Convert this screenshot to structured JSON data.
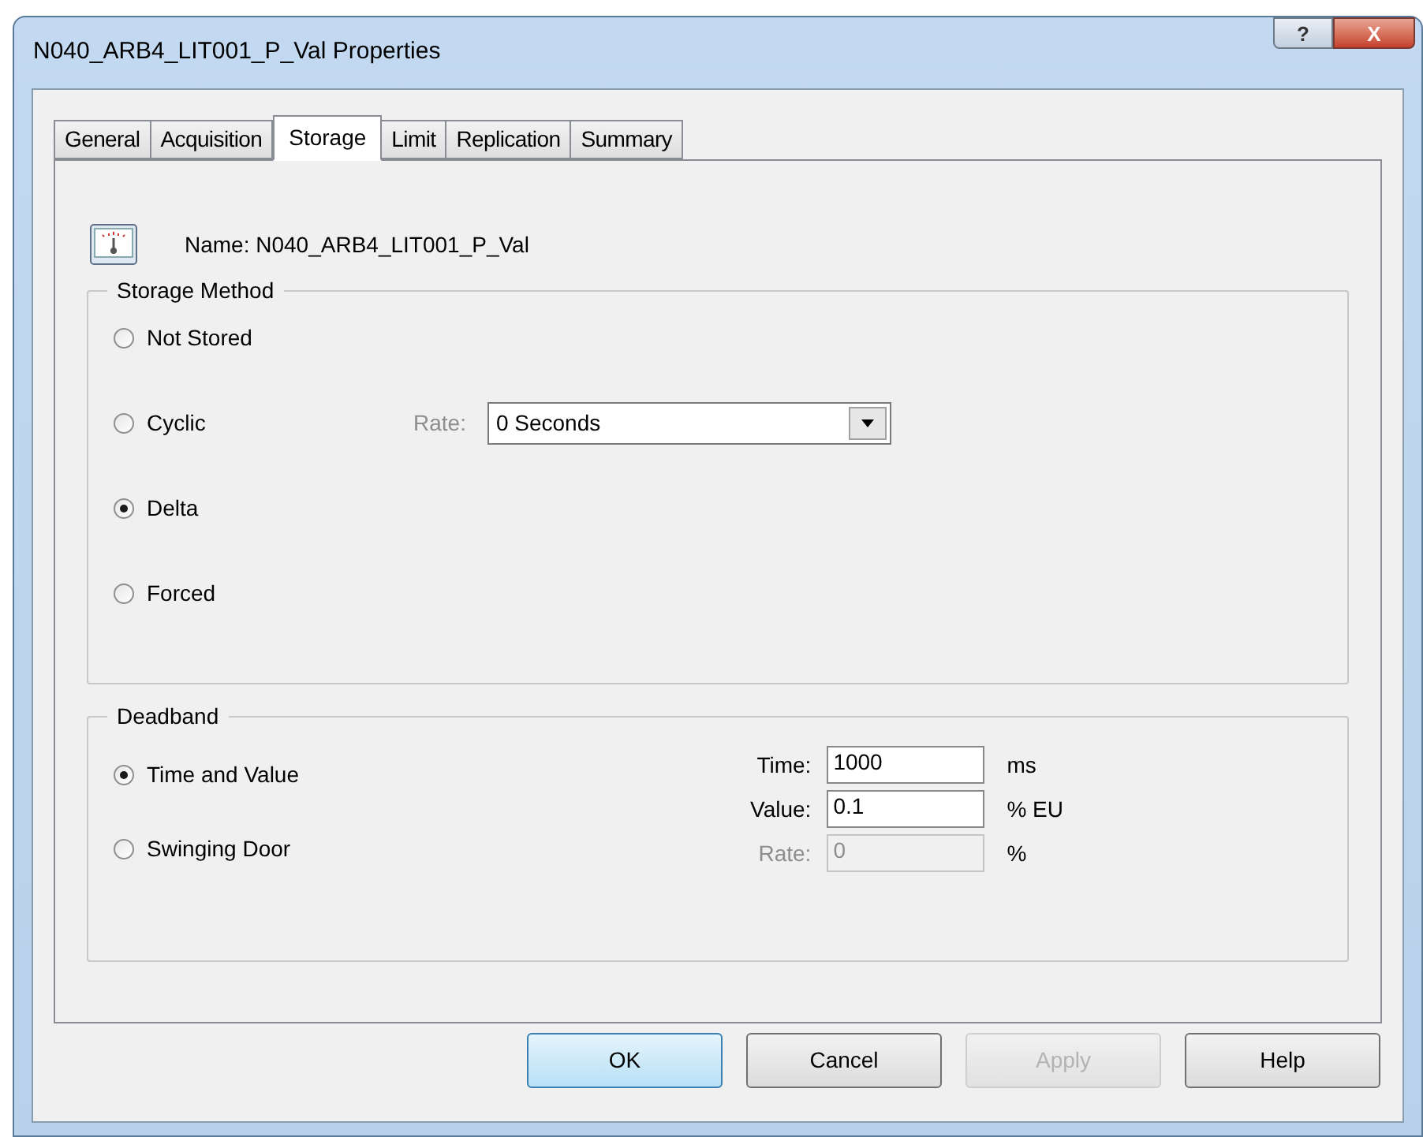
{
  "window": {
    "title": "N040_ARB4_LIT001_P_Val Properties",
    "help_button": "?",
    "close_button": "X"
  },
  "tabs": [
    {
      "label": "General",
      "selected": false
    },
    {
      "label": "Acquisition",
      "selected": false
    },
    {
      "label": "Storage",
      "selected": true
    },
    {
      "label": "Limit",
      "selected": false
    },
    {
      "label": "Replication",
      "selected": false
    },
    {
      "label": "Summary",
      "selected": false
    }
  ],
  "name_label": "Name: N040_ARB4_LIT001_P_Val",
  "storage_method": {
    "title": "Storage Method",
    "options": [
      {
        "label": "Not Stored",
        "selected": false
      },
      {
        "label": "Cyclic",
        "selected": false
      },
      {
        "label": "Delta",
        "selected": true
      },
      {
        "label": "Forced",
        "selected": false
      }
    ],
    "rate": {
      "label": "Rate:",
      "disabled": true,
      "value": "0 Seconds"
    }
  },
  "deadband": {
    "title": "Deadband",
    "options": [
      {
        "label": "Time and Value",
        "selected": true
      },
      {
        "label": "Swinging Door",
        "selected": false
      }
    ],
    "fields": [
      {
        "label": "Time:",
        "value": "1000",
        "unit": "ms",
        "disabled": false
      },
      {
        "label": "Value:",
        "value": "0.1",
        "unit": "% EU",
        "disabled": false
      },
      {
        "label": "Rate:",
        "value": "0",
        "unit": "%",
        "disabled": true
      }
    ]
  },
  "buttons": [
    {
      "label": "OK",
      "default": true,
      "disabled": false
    },
    {
      "label": "Cancel",
      "default": false,
      "disabled": false
    },
    {
      "label": "Apply",
      "default": false,
      "disabled": true
    },
    {
      "label": "Help",
      "default": false,
      "disabled": false
    }
  ]
}
